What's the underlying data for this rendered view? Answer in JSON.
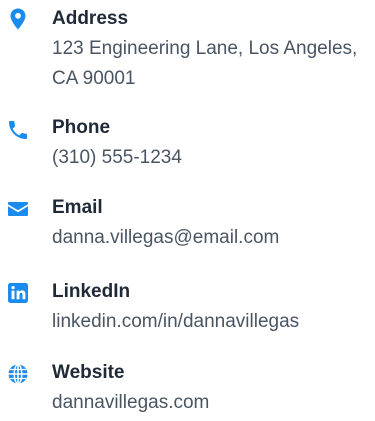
{
  "accent_color": "#1a8cf0",
  "contacts": {
    "address": {
      "icon": "map-pin-icon",
      "label": "Address",
      "value": "123 Engineering Lane, Los Angeles, CA 90001"
    },
    "phone": {
      "icon": "phone-icon",
      "label": "Phone",
      "value": "(310) 555-1234"
    },
    "email": {
      "icon": "envelope-icon",
      "label": "Email",
      "value": "danna.villegas@email.com"
    },
    "linkedin": {
      "icon": "linkedin-icon",
      "label": "LinkedIn",
      "value": "linkedin.com/in/dannavillegas"
    },
    "website": {
      "icon": "globe-icon",
      "label": "Website",
      "value": "dannavillegas.com"
    }
  }
}
